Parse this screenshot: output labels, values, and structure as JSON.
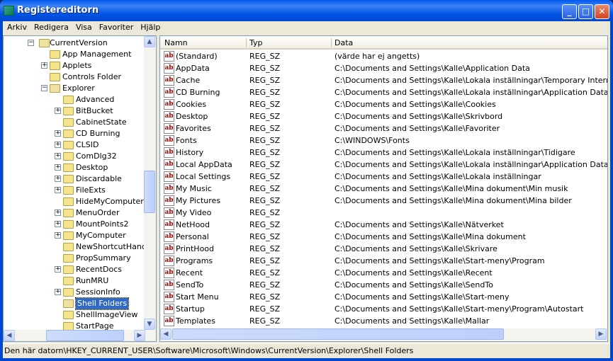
{
  "window": {
    "title": "Registereditorn"
  },
  "menu": [
    "Arkiv",
    "Redigera",
    "Visa",
    "Favoriter",
    "Hjälp"
  ],
  "tree": [
    {
      "label": "CurrentVersion",
      "level": 0,
      "exp": "-",
      "open": true
    },
    {
      "label": "App Management",
      "level": 1,
      "exp": ""
    },
    {
      "label": "Applets",
      "level": 1,
      "exp": "+"
    },
    {
      "label": "Controls Folder",
      "level": 1,
      "exp": ""
    },
    {
      "label": "Explorer",
      "level": 1,
      "exp": "-",
      "open": true
    },
    {
      "label": "Advanced",
      "level": 2,
      "exp": ""
    },
    {
      "label": "BitBucket",
      "level": 2,
      "exp": "+"
    },
    {
      "label": "CabinetState",
      "level": 2,
      "exp": ""
    },
    {
      "label": "CD Burning",
      "level": 2,
      "exp": "+"
    },
    {
      "label": "CLSID",
      "level": 2,
      "exp": "+"
    },
    {
      "label": "ComDlg32",
      "level": 2,
      "exp": "+"
    },
    {
      "label": "Desktop",
      "level": 2,
      "exp": "+"
    },
    {
      "label": "Discardable",
      "level": 2,
      "exp": "+"
    },
    {
      "label": "FileExts",
      "level": 2,
      "exp": "+"
    },
    {
      "label": "HideMyComputerIcons",
      "level": 2,
      "exp": ""
    },
    {
      "label": "MenuOrder",
      "level": 2,
      "exp": "+"
    },
    {
      "label": "MountPoints2",
      "level": 2,
      "exp": "+"
    },
    {
      "label": "MyComputer",
      "level": 2,
      "exp": "+"
    },
    {
      "label": "NewShortcutHandlers",
      "level": 2,
      "exp": ""
    },
    {
      "label": "PropSummary",
      "level": 2,
      "exp": ""
    },
    {
      "label": "RecentDocs",
      "level": 2,
      "exp": "+"
    },
    {
      "label": "RunMRU",
      "level": 2,
      "exp": ""
    },
    {
      "label": "SessionInfo",
      "level": 2,
      "exp": "+"
    },
    {
      "label": "Shell Folders",
      "level": 2,
      "exp": "",
      "selected": true,
      "open": true
    },
    {
      "label": "ShellImageView",
      "level": 2,
      "exp": ""
    },
    {
      "label": "StartPage",
      "level": 2,
      "exp": ""
    }
  ],
  "columns": [
    "Namn",
    "Typ",
    "Data"
  ],
  "values": [
    [
      "(Standard)",
      "REG_SZ",
      "(värde har ej angetts)"
    ],
    [
      "AppData",
      "REG_SZ",
      "C:\\Documents and Settings\\Kalle\\Application Data"
    ],
    [
      "Cache",
      "REG_SZ",
      "C:\\Documents and Settings\\Kalle\\Lokala inställningar\\Temporary Internet Files"
    ],
    [
      "CD Burning",
      "REG_SZ",
      "C:\\Documents and Settings\\Kalle\\Lokala inställningar\\Application Data\\Microsoft\\CD Burning"
    ],
    [
      "Cookies",
      "REG_SZ",
      "C:\\Documents and Settings\\Kalle\\Cookies"
    ],
    [
      "Desktop",
      "REG_SZ",
      "C:\\Documents and Settings\\Kalle\\Skrivbord"
    ],
    [
      "Favorites",
      "REG_SZ",
      "C:\\Documents and Settings\\Kalle\\Favoriter"
    ],
    [
      "Fonts",
      "REG_SZ",
      "C:\\WINDOWS\\Fonts"
    ],
    [
      "History",
      "REG_SZ",
      "C:\\Documents and Settings\\Kalle\\Lokala inställningar\\Tidigare"
    ],
    [
      "Local AppData",
      "REG_SZ",
      "C:\\Documents and Settings\\Kalle\\Lokala inställningar\\Application Data"
    ],
    [
      "Local Settings",
      "REG_SZ",
      "C:\\Documents and Settings\\Kalle\\Lokala inställningar"
    ],
    [
      "My Music",
      "REG_SZ",
      "C:\\Documents and Settings\\Kalle\\Mina dokument\\Min musik"
    ],
    [
      "My Pictures",
      "REG_SZ",
      "C:\\Documents and Settings\\Kalle\\Mina dokument\\Mina bilder"
    ],
    [
      "My Video",
      "REG_SZ",
      ""
    ],
    [
      "NetHood",
      "REG_SZ",
      "C:\\Documents and Settings\\Kalle\\Nätverket"
    ],
    [
      "Personal",
      "REG_SZ",
      "C:\\Documents and Settings\\Kalle\\Mina dokument"
    ],
    [
      "PrintHood",
      "REG_SZ",
      "C:\\Documents and Settings\\Kalle\\Skrivare"
    ],
    [
      "Programs",
      "REG_SZ",
      "C:\\Documents and Settings\\Kalle\\Start-meny\\Program"
    ],
    [
      "Recent",
      "REG_SZ",
      "C:\\Documents and Settings\\Kalle\\Recent"
    ],
    [
      "SendTo",
      "REG_SZ",
      "C:\\Documents and Settings\\Kalle\\SendTo"
    ],
    [
      "Start Menu",
      "REG_SZ",
      "C:\\Documents and Settings\\Kalle\\Start-meny"
    ],
    [
      "Startup",
      "REG_SZ",
      "C:\\Documents and Settings\\Kalle\\Start-meny\\Program\\Autostart"
    ],
    [
      "Templates",
      "REG_SZ",
      "C:\\Documents and Settings\\Kalle\\Mallar"
    ]
  ],
  "icons": {
    "value": "ab",
    "minimize": "_",
    "maximize": "□",
    "close": "✕"
  },
  "status": "Den här datorn\\HKEY_CURRENT_USER\\Software\\Microsoft\\Windows\\CurrentVersion\\Explorer\\Shell Folders"
}
